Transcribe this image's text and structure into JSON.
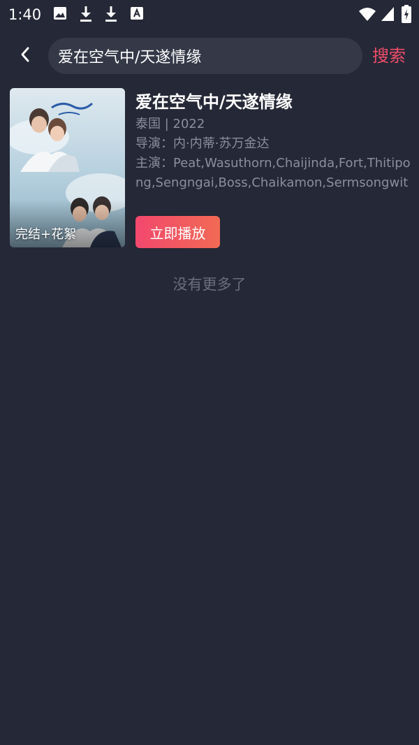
{
  "status_bar": {
    "time": "1:40",
    "icons": [
      "image-icon",
      "download-icon",
      "download-icon",
      "translate-a-icon",
      "wifi-icon",
      "signal-icon",
      "battery-charging-icon"
    ]
  },
  "header": {
    "back_icon": "chevron-left-icon",
    "search_value": "爱在空气中/天遂情缘",
    "search_button_label": "搜索"
  },
  "results": [
    {
      "title": "爱在空气中/天遂情缘",
      "region_year": "泰国 | 2022",
      "director": "导演：内·内蒂·苏万金达",
      "cast": "主演：Peat,Wasuthorn,Chaijinda,Fort,Thitipong,Sengngai,Boss,Chaikamon,Sermsongwitt",
      "badge": "完结+花絮",
      "play_label": "立即播放"
    }
  ],
  "footer": {
    "no_more": "没有更多了"
  },
  "colors": {
    "background": "#252836",
    "search_box": "#343847",
    "accent": "#ee4d6a",
    "muted_text": "#8a8f9f"
  }
}
